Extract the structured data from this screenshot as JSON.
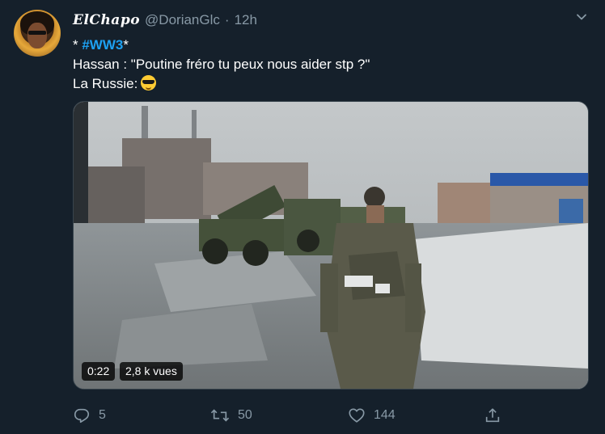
{
  "tweet": {
    "display_name": "ElChapo",
    "handle": "@DorianGlc",
    "separator": "·",
    "time": "12h",
    "lines": {
      "hashtag_prefix": "* ",
      "hashtag": "#WW3",
      "hashtag_suffix": "*",
      "line2": "Hassan : \"Poutine fréro tu peux nous aider stp ?\"",
      "line3": "La Russie:"
    },
    "emoji": "sunglasses-face-emoji"
  },
  "media": {
    "duration": "0:22",
    "views": "2,8 k vues"
  },
  "actions": {
    "replies": "5",
    "retweets": "50",
    "likes": "144"
  },
  "colors": {
    "background": "#15202b",
    "accent": "#1da1f2",
    "muted": "#8899a6"
  }
}
